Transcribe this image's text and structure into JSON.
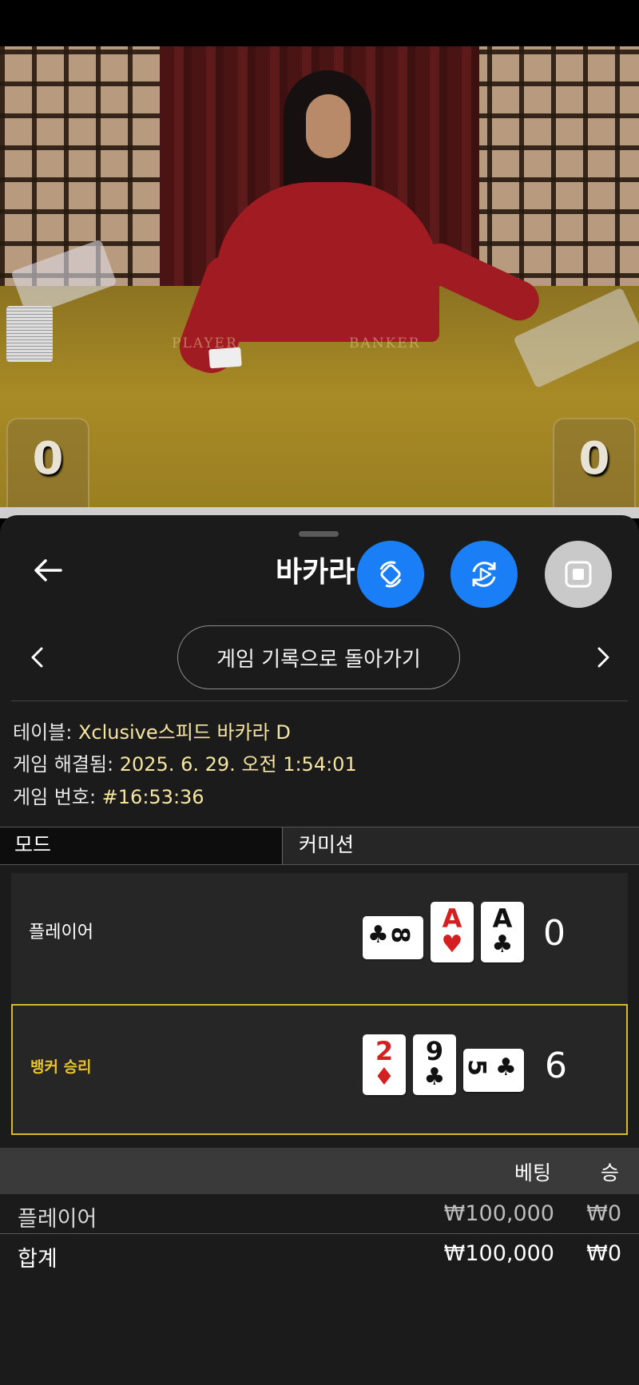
{
  "video": {
    "felt_player_label": "PLAYER",
    "felt_banker_label": "BANKER",
    "player_score": "0",
    "banker_score": "0"
  },
  "panel": {
    "title": "바카라",
    "history_button": "게임 기록으로 돌아가기",
    "info": {
      "table_label": "테이블: ",
      "table_value": "Xclusive스피드 바카라 D",
      "resolved_label": "게임 해결됨: ",
      "resolved_value": "2025. 6. 29. 오전 1:54:01",
      "number_label": "게임 번호: ",
      "number_value": "#16:53:36"
    },
    "mode": {
      "left": "모드",
      "right": "커미션"
    },
    "hands": {
      "player": {
        "label": "플레이어",
        "score": "0",
        "cards": [
          {
            "rank": "8",
            "suit": "♣",
            "orientation": "sideways"
          },
          {
            "rank": "A",
            "suit": "♥",
            "orientation": "upright"
          },
          {
            "rank": "A",
            "suit": "♣",
            "orientation": "upright"
          }
        ]
      },
      "banker": {
        "label": "뱅커 승리",
        "score": "6",
        "cards": [
          {
            "rank": "2",
            "suit": "♦",
            "orientation": "upright"
          },
          {
            "rank": "9",
            "suit": "♣",
            "orientation": "upright"
          },
          {
            "rank": "5",
            "suit": "♣",
            "orientation": "sideways"
          }
        ]
      }
    },
    "bets": {
      "header_bet": "베팅",
      "header_win": "승",
      "rows": [
        {
          "label": "플레이어",
          "bet": "₩100,000",
          "win": "₩0"
        },
        {
          "label": "합계",
          "bet": "₩100,000",
          "win": "₩0"
        }
      ]
    }
  },
  "colors": {
    "accent_blue": "#1a7ff7",
    "winner_gold": "#e8c42a",
    "info_value": "#f6e6a0"
  },
  "icons": [
    "arrow-left-icon",
    "rotate-icon",
    "replay-icon",
    "stop-icon",
    "chevron-left-icon",
    "chevron-right-icon"
  ]
}
